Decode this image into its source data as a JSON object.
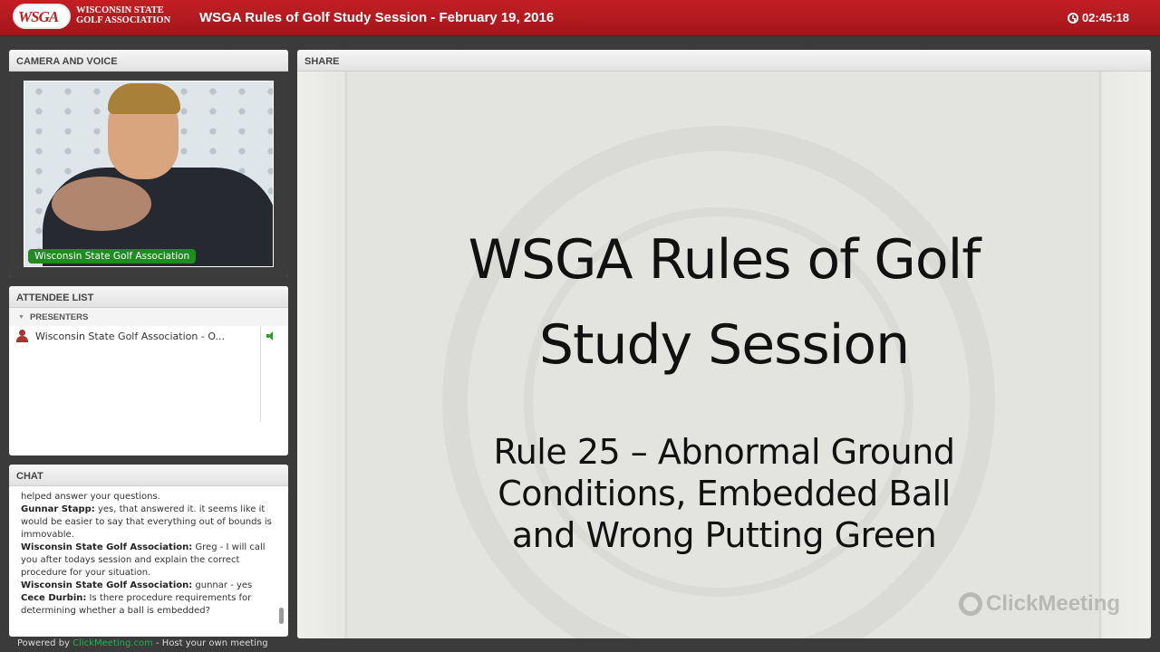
{
  "header": {
    "logo_mark": "WSGA",
    "logo_line1": "Wisconsin State",
    "logo_line2": "Golf Association",
    "title": "WSGA Rules of Golf Study Session - February 19, 2016",
    "timer": "02:45:18"
  },
  "camera": {
    "heading": "CAMERA AND VOICE",
    "name_tag": "Wisconsin State Golf Association"
  },
  "attendees": {
    "heading": "ATTENDEE LIST",
    "group": "PRESENTERS",
    "items": [
      {
        "name": "Wisconsin State Golf Association - O..."
      }
    ]
  },
  "chat": {
    "heading": "CHAT",
    "messages": [
      {
        "author": "",
        "text": "helped answer your questions."
      },
      {
        "author": "Gunnar Stapp:",
        "text": " yes, that answered it.  it seems like it would be easier to say that everything out of bounds is immovable."
      },
      {
        "author": "Wisconsin State Golf Association:",
        "text": " Greg - I will call you after todays session and explain the correct procedure for your situation."
      },
      {
        "author": "Wisconsin State Golf Association:",
        "text": " gunnar - yes"
      },
      {
        "author": "Cece Durbin:",
        "text": " Is there procedure requirements for determining whether a ball is embedded?"
      }
    ]
  },
  "footer": {
    "prefix": "Powered by ",
    "link": "ClickMeeting.com",
    "suffix": " - Host your own meeting"
  },
  "share": {
    "heading": "SHARE",
    "slide_title_line1": "WSGA Rules of Golf",
    "slide_title_line2": "Study Session",
    "slide_sub_line1": "Rule 25 – Abnormal Ground",
    "slide_sub_line2": "Conditions, Embedded Ball",
    "slide_sub_line3": "and Wrong Putting Green",
    "watermark": "ClickMeeting"
  },
  "colors": {
    "brand": "#c21f24",
    "accent": "#1f8c1f"
  },
  "icons": [
    "clock-icon",
    "user-icon",
    "speaker-icon",
    "collapse-triangle-icon",
    "clickmeeting-logo-icon"
  ]
}
